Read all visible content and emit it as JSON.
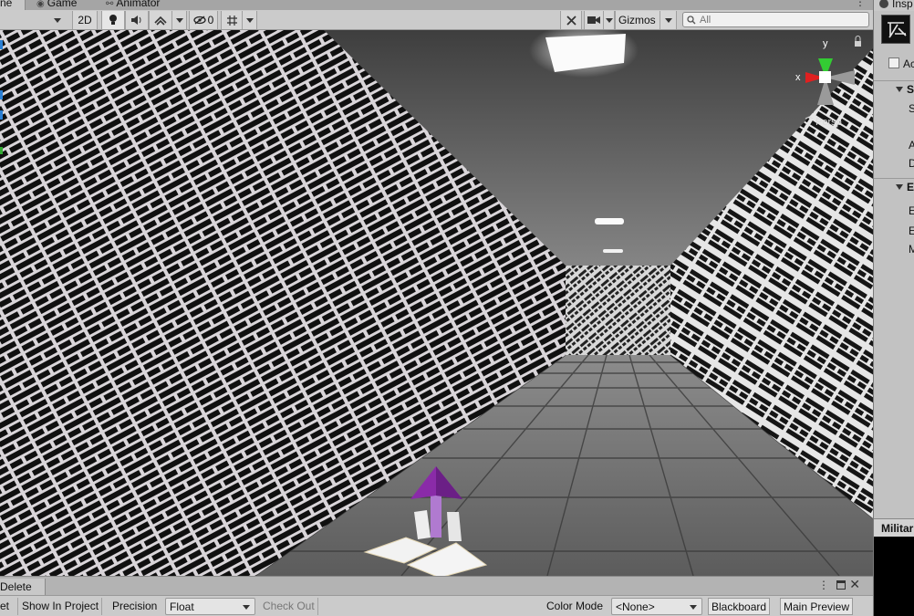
{
  "tabs": {
    "scene": "ne",
    "game": "Game",
    "animator": "Animator"
  },
  "toolbar": {
    "mode_2d": "2D",
    "hidden_count": "0",
    "gizmos": "Gizmos",
    "search_placeholder": "All"
  },
  "viewport": {
    "persp_label": "Persp",
    "axis_x": "x",
    "axis_y": "y"
  },
  "bottom_panel": {
    "tab": "Delete",
    "items": {
      "et": "et",
      "show_in_project": "Show In Project",
      "precision_label": "Precision",
      "precision_value": "Float",
      "check_out": "Check Out",
      "color_mode_label": "Color Mode",
      "color_mode_value": "<None>",
      "blackboard": "Blackboard",
      "main_preview": "Main Preview"
    }
  },
  "inspector": {
    "tab": "Insp",
    "check_label": "Ac",
    "rows": [
      "S",
      "S",
      "A",
      "D",
      "E",
      "E",
      "E",
      "M"
    ],
    "bottom_title": "Militar"
  },
  "colors": {
    "gizmo_x": "#e02020",
    "gizmo_y": "#33cc33",
    "arrow_purple": "#8a2ba8"
  }
}
